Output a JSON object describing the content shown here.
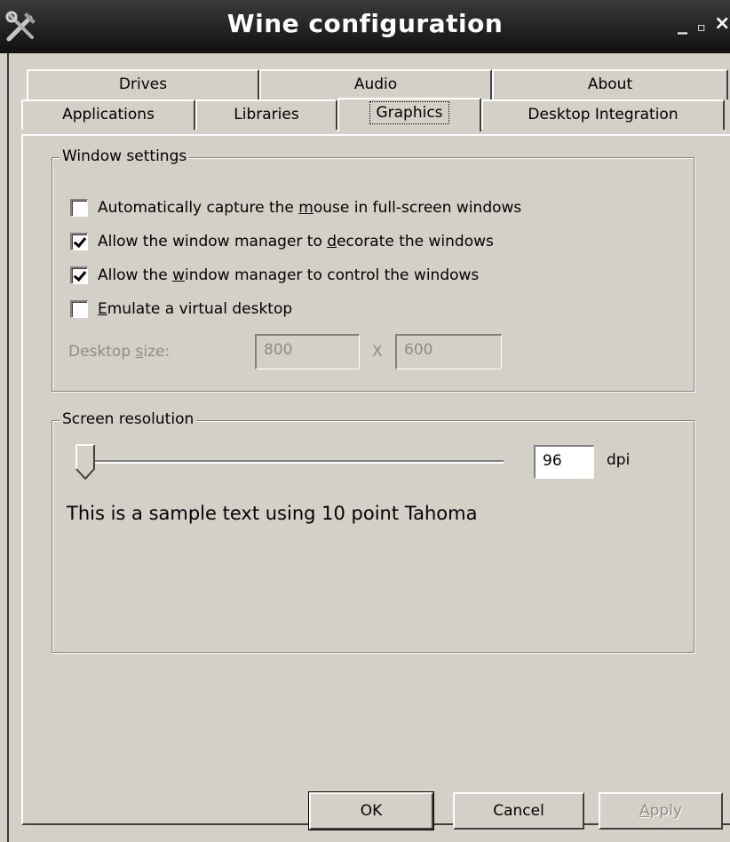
{
  "window": {
    "title": "Wine configuration",
    "icon": "wine-tools-icon",
    "controls": {
      "minimize": "_",
      "maximize": "▫",
      "close": "×"
    }
  },
  "tabs": {
    "row1": [
      {
        "label": "Drives",
        "active": false
      },
      {
        "label": "Audio",
        "active": false
      },
      {
        "label": "About",
        "active": false
      }
    ],
    "row2": [
      {
        "label": "Applications",
        "active": false
      },
      {
        "label": "Libraries",
        "active": false
      },
      {
        "label": "Graphics",
        "active": true
      },
      {
        "label": "Desktop Integration",
        "active": false
      }
    ]
  },
  "window_settings": {
    "title": "Window settings",
    "options": [
      {
        "label_before": "Automatically capture the ",
        "mnemonic": "m",
        "label_after": "ouse in full-screen windows",
        "checked": false
      },
      {
        "label_before": "Allow the window manager to ",
        "mnemonic": "d",
        "label_after": "ecorate the windows",
        "checked": true
      },
      {
        "label_before": "Allow the ",
        "mnemonic": "w",
        "label_after": "indow manager to control the windows",
        "checked": true
      },
      {
        "label_before": "",
        "mnemonic": "E",
        "label_after": "mulate a virtual desktop",
        "checked": false
      }
    ],
    "desktop_size": {
      "label_before": "Desktop ",
      "mnemonic": "s",
      "label_after": "ize:",
      "width": "800",
      "separator": "X",
      "height": "600"
    }
  },
  "screen_resolution": {
    "title": "Screen resolution",
    "dpi_value": "96",
    "dpi_unit": "dpi",
    "sample_text": "This is a sample text using 10 point Tahoma"
  },
  "buttons": {
    "ok": "OK",
    "cancel": "Cancel",
    "apply_mnemonic": "A",
    "apply_rest": "pply"
  },
  "colors": {
    "face": "#d4d0c8",
    "titlebar": "#1a1a1a",
    "disabled_text": "#8f8c86"
  }
}
